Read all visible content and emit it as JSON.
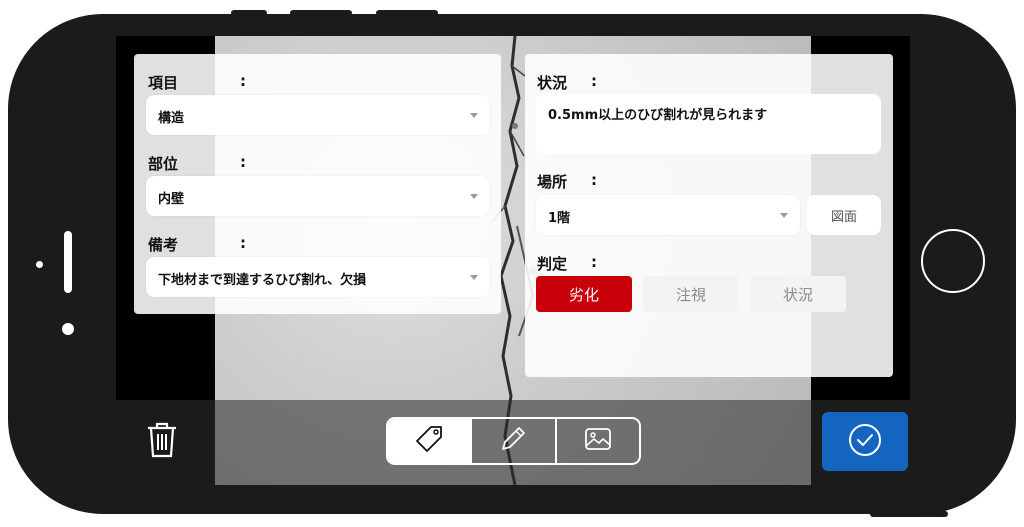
{
  "left_panel": {
    "field1": {
      "label": "項目",
      "colon": ":",
      "value": "構造"
    },
    "field2": {
      "label": "部位",
      "colon": ":",
      "value": "内壁"
    },
    "field3": {
      "label": "備考",
      "colon": ":",
      "value": "下地材まで到達するひび割れ、欠損"
    }
  },
  "right_panel": {
    "status": {
      "label": "状況",
      "colon": ":",
      "value": "0.5mm以上のひび割れが見られます"
    },
    "location": {
      "label": "場所",
      "colon": ":",
      "value": "1階",
      "drawing_button": "図面"
    },
    "judgement": {
      "label": "判定",
      "colon": ":",
      "options": [
        "劣化",
        "注視",
        "状況"
      ],
      "selected": "劣化",
      "selected_color": "#c8000a"
    }
  },
  "toolbar": {
    "delete_icon": "trash-icon",
    "tabs": [
      {
        "icon": "tag-icon",
        "active": true
      },
      {
        "icon": "pencil-icon",
        "active": false
      },
      {
        "icon": "image-icon",
        "active": false
      }
    ],
    "confirm_icon": "check-circle-icon",
    "confirm_color": "#1365c0"
  }
}
